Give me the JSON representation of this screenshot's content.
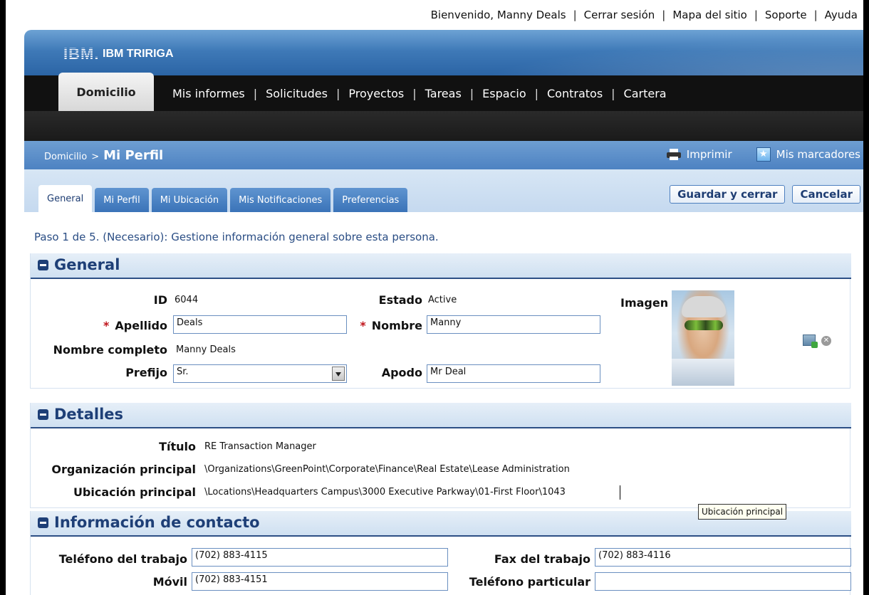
{
  "util_links": [
    "Bienvenido, Manny Deals",
    "Cerrar sesión",
    "Mapa del sitio",
    "Soporte",
    "Ayuda"
  ],
  "brand": {
    "logo": "IBM.",
    "name": "IBM TRIRIGA"
  },
  "nav": {
    "active": "Domicilio",
    "items": [
      "Mis informes",
      "Solicitudes",
      "Proyectos",
      "Tareas",
      "Espacio",
      "Contratos",
      "Cartera"
    ]
  },
  "pagebar": {
    "crumb": "Domicilio",
    "crumb_sep": ">",
    "title": "Mi Perfil",
    "print": "Imprimir",
    "bookmarks": "Mis marcadores"
  },
  "tabs": [
    "General",
    "Mi Perfil",
    "Mi Ubicación",
    "Mis Notificaciones",
    "Preferencias"
  ],
  "actions": {
    "save": "Guardar y cerrar",
    "cancel": "Cancelar"
  },
  "step_text": "Paso 1 de 5. (Necesario): Gestione información general sobre esta persona.",
  "general": {
    "title": "General",
    "id_label": "ID",
    "id_value": "6044",
    "estado_label": "Estado",
    "estado_value": "Active",
    "imagen_label": "Imagen",
    "apellido_label": "Apellido",
    "apellido_value": "Deals",
    "nombre_label": "Nombre",
    "nombre_value": "Manny",
    "completo_label": "Nombre completo",
    "completo_value": "Manny Deals",
    "prefijo_label": "Prefijo",
    "prefijo_value": "Sr.",
    "apodo_label": "Apodo",
    "apodo_value": "Mr Deal",
    "required_mark": "*"
  },
  "detalles": {
    "title": "Detalles",
    "titulo_label": "Título",
    "titulo_value": "RE Transaction Manager",
    "org_label": "Organización principal",
    "org_value": "\\Organizations\\GreenPoint\\Corporate\\Finance\\Real Estate\\Lease Administration",
    "ubic_label": "Ubicación principal",
    "ubic_value": "\\Locations\\Headquarters Campus\\3000 Executive Parkway\\01-First Floor\\1043"
  },
  "tooltip": "Ubicación principal",
  "contacto": {
    "title": "Información de contacto",
    "tel_trabajo_label": "Teléfono del trabajo",
    "tel_trabajo_value": "(702) 883-4115",
    "fax_label": "Fax del trabajo",
    "fax_value": "(702) 883-4116",
    "movil_label": "Móvil",
    "movil_value": "(702) 883-4151",
    "tel_part_label": "Teléfono particular",
    "tel_part_value": ""
  },
  "icons": {
    "remove": "✕",
    "bookmark": "★"
  }
}
